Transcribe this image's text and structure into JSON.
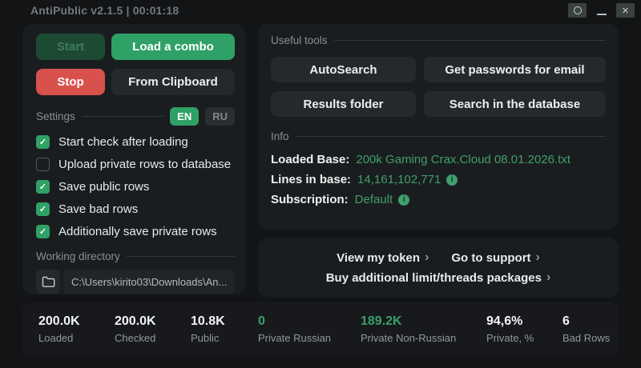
{
  "window": {
    "title": "AntiPublic v2.1.5 | 00:01:18"
  },
  "icons": {
    "check": "✓",
    "chevron": "›",
    "close": "✕",
    "info": "i"
  },
  "controls": {
    "start": "Start",
    "load_combo": "Load a combo",
    "stop": "Stop",
    "from_clipboard": "From Clipboard"
  },
  "settings": {
    "label": "Settings",
    "languages": [
      {
        "label": "EN",
        "active": true
      },
      {
        "label": "RU",
        "active": false
      }
    ],
    "checkboxes": [
      {
        "label": "Start check after loading",
        "checked": true
      },
      {
        "label": "Upload private rows to database",
        "checked": false
      },
      {
        "label": "Save public rows",
        "checked": true
      },
      {
        "label": "Save bad rows",
        "checked": true
      },
      {
        "label": "Additionally save private rows",
        "checked": true
      }
    ]
  },
  "working_directory": {
    "label": "Working directory",
    "path": "C:\\Users\\kirito03\\Downloads\\An..."
  },
  "tools": {
    "label": "Useful tools",
    "buttons": [
      "AutoSearch",
      "Get passwords for email",
      "Results folder",
      "Search in the database"
    ]
  },
  "info": {
    "label": "Info",
    "rows": [
      {
        "key": "Loaded Base:",
        "value": "200k Gaming Crax.Cloud 08.01.2026.txt",
        "has_info_icon": false
      },
      {
        "key": "Lines in base:",
        "value": "14,161,102,771",
        "has_info_icon": true
      },
      {
        "key": "Subscription:",
        "value": "Default",
        "has_info_icon": true
      }
    ]
  },
  "links": [
    {
      "label": "View my token"
    },
    {
      "label": "Go to support"
    },
    {
      "label": "Buy additional limit/threads packages"
    }
  ],
  "stats": [
    {
      "value": "200.0K",
      "label": "Loaded",
      "variant": "default"
    },
    {
      "value": "200.0K",
      "label": "Checked",
      "variant": "default"
    },
    {
      "value": "10.8K",
      "label": "Public",
      "variant": "default"
    },
    {
      "value": "0",
      "label": "Private Russian",
      "variant": "green"
    },
    {
      "value": "189.2K",
      "label": "Private Non-Russian",
      "variant": "green"
    },
    {
      "value": "94,6%",
      "label": "Private, %",
      "variant": "default"
    },
    {
      "value": "6",
      "label": "Bad Rows",
      "variant": "default"
    }
  ],
  "colors": {
    "accent_green": "#2fa166",
    "stop_red": "#d8514d",
    "value_green": "#3aa06b"
  }
}
